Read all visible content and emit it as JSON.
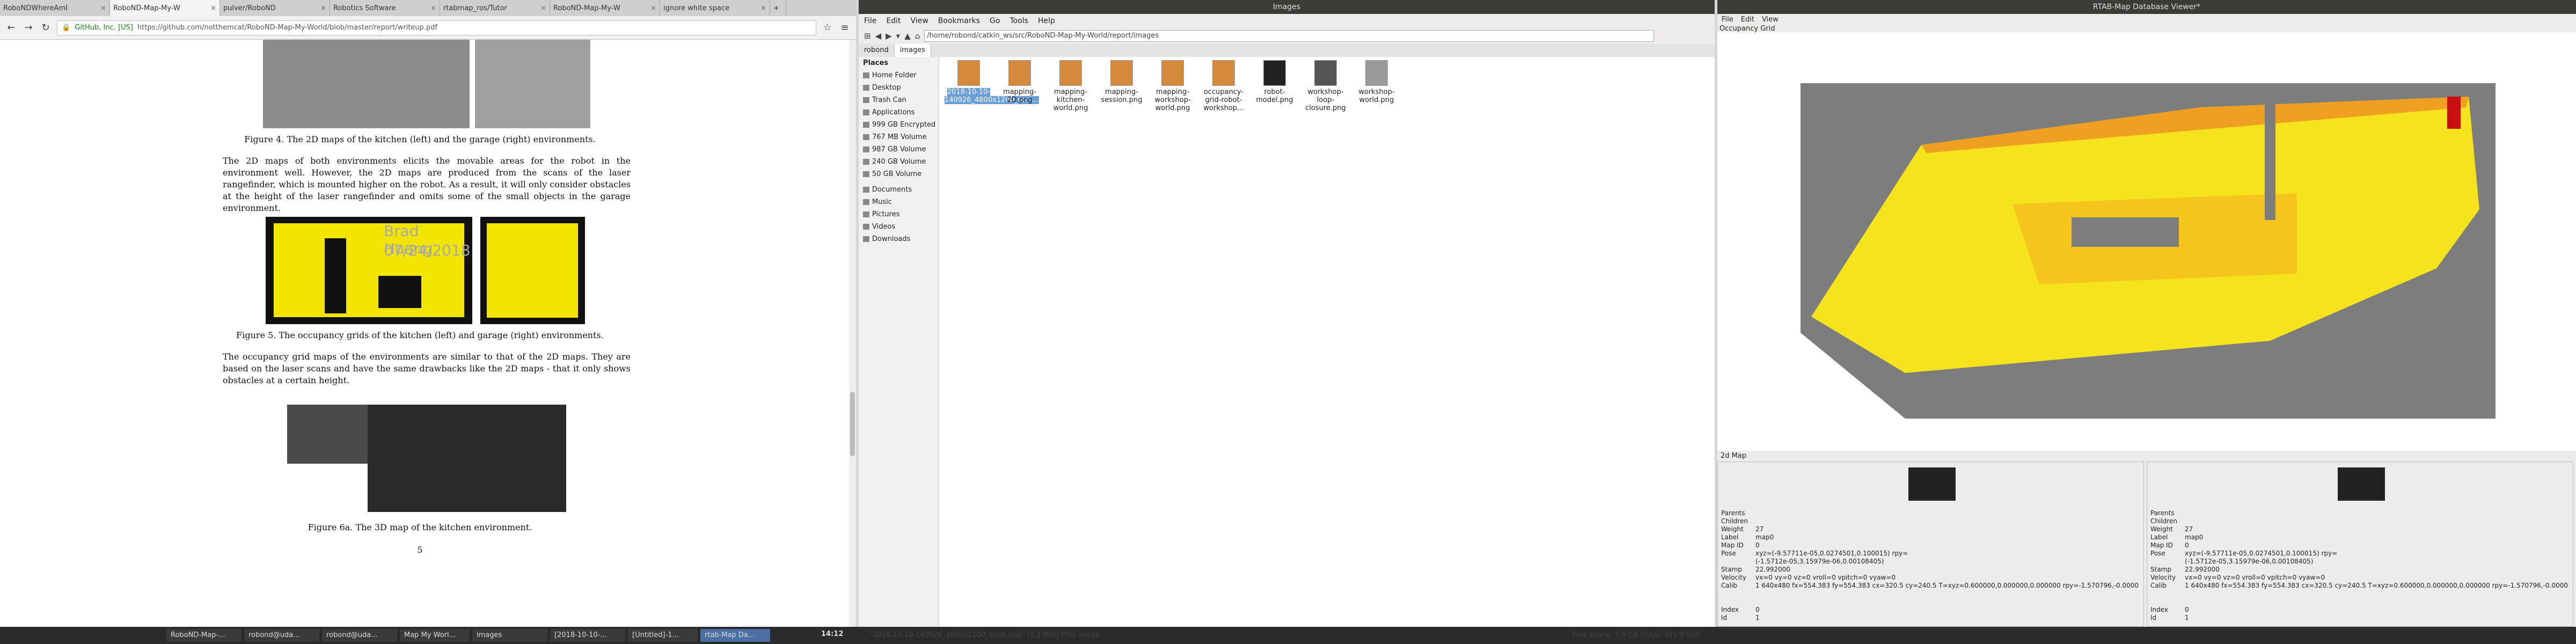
{
  "browser": {
    "tabs": [
      {
        "label": "RoboNDWhereAmI"
      },
      {
        "label": "RoboND-Map-My-W"
      },
      {
        "label": "pulver/RoboND"
      },
      {
        "label": "Robotics Software"
      },
      {
        "label": "rtabmap_ros/Tutor"
      },
      {
        "label": "RoboND-Map-My-W"
      },
      {
        "label": "ignore white space"
      }
    ],
    "identity": "GitHub, Inc. [US]",
    "url": "https://github.com/notthemcat/RoboND-Map-My-World/blob/master/report/writeup.pdf"
  },
  "pdf": {
    "fig4": "Figure 4.  The 2D maps of the kitchen (left) and the garage (right) environments.",
    "para1": "The 2D maps of both environments elicits the movable areas for the robot in the environment well. However, the 2D maps are produced from the scans of the laser rangefinder, which is mounted higher on the robot. As a result, it will only consider obstacles at the height of the laser rangefinder and omits some of the small objects in the garage environment.",
    "fig5": "Figure 5.  The occupancy grids of the kitchen (left) and garage (right) environments.",
    "para2": "The occupancy grid maps of the environments are similar to that of the 2D maps. They are based on the laser scans and have the same drawbacks like the 2D maps - that it only shows obstacles at a certain height.",
    "fig6": "Figure 6a.  The 3D map of the kitchen environment.",
    "pageno": "5",
    "wm_name": "Brad Huang",
    "wm_date": "07/24/2018"
  },
  "fm": {
    "title": "Images",
    "menu": [
      "File",
      "Edit",
      "View",
      "Bookmarks",
      "Go",
      "Tools",
      "Help"
    ],
    "path": "/home/robond/catkin_ws/src/RoboND-Map-My-World/report/images",
    "tabs": [
      "robond",
      "images"
    ],
    "places_label": "Places",
    "places": [
      "Home Folder",
      "Desktop",
      "Trash Can",
      "Applications",
      "999 GB Encrypted",
      "767 MB Volume",
      "987 GB Volume",
      "240 GB Volume",
      "50 GB Volume",
      "Documents",
      "Music",
      "Pictures",
      "Videos",
      "Downloads"
    ],
    "files": [
      {
        "name": "2018-10-10-140926_4800x1200_scro..."
      },
      {
        "name": "mapping-2D.png"
      },
      {
        "name": "mapping-kitchen-world.png"
      },
      {
        "name": "mapping-session.png"
      },
      {
        "name": "mapping-workshop-world.png"
      },
      {
        "name": "occupancy-grid-robot-workshop..."
      },
      {
        "name": "robot-model.png"
      },
      {
        "name": "workshop-loop-closure.png"
      },
      {
        "name": "workshop-world.png"
      }
    ],
    "status": "\"2018-10-10-140926_4800x1200_scrot.png\" (1.1 MiB) PNG image",
    "free": "Free space: 7.9 GB (Total: 391.9 GiB)"
  },
  "rt": {
    "title": "RTAB-Map Database Viewer*",
    "menu": [
      "File",
      "Edit",
      "View"
    ],
    "grid_label": "Occupancy Grid",
    "map2d": "2d Map",
    "panels": [
      {
        "rows": [
          [
            "Parents",
            ""
          ],
          [
            "Children",
            ""
          ],
          [
            "Weight",
            "27"
          ],
          [
            "Label",
            "map0"
          ],
          [
            "Map ID",
            "0"
          ],
          [
            "Pose",
            "xyz=(-9.57711e-05,0.0274501,0.100015) rpy=(-1.5712e-05,3.15979e-06,0.00108405)"
          ],
          [
            "Stamp",
            "22.992000"
          ],
          [
            "Velocity",
            "vx=0 vy=0 vz=0 vroll=0 vpitch=0 vyaw=0"
          ],
          [
            "Calib",
            "1 640x480 fx=554.383 fy=554.383 cx=320.5 cy=240.5 T=xyz=0.600000,0.000000,0.000000 rpy=-1.570796,-0.0000"
          ],
          [
            "Index",
            "0"
          ],
          [
            "Id",
            "1"
          ]
        ]
      },
      {
        "rows": [
          [
            "Parents",
            ""
          ],
          [
            "Children",
            ""
          ],
          [
            "Weight",
            "27"
          ],
          [
            "Label",
            "map0"
          ],
          [
            "Map ID",
            "0"
          ],
          [
            "Pose",
            "xyz=(-9.57711e-05,0.0274501,0.100015) rpy=(-1.5712e-05,3.15979e-06,0.00108405)"
          ],
          [
            "Stamp",
            "22.992000"
          ],
          [
            "Velocity",
            "vx=0 vy=0 vz=0 vroll=0 vpitch=0 vyaw=0"
          ],
          [
            "Calib",
            "1 640x480 fx=554.383 fy=554.383 cx=320.5 cy=240.5 T=xyz=0.600000,0.000000,0.000000 rpy=-1.570796,-0.0000"
          ],
          [
            "Index",
            "0"
          ],
          [
            "Id",
            "1"
          ]
        ]
      }
    ]
  },
  "taskbar": {
    "items": [
      "RoboND-Map-...",
      "robond@uda...",
      "robond@uda...",
      "Map My Worl...",
      "images",
      "[2018-10-10-...",
      "[Untitled]-1...",
      "rtab-Map Da..."
    ],
    "clock": "14:12"
  }
}
